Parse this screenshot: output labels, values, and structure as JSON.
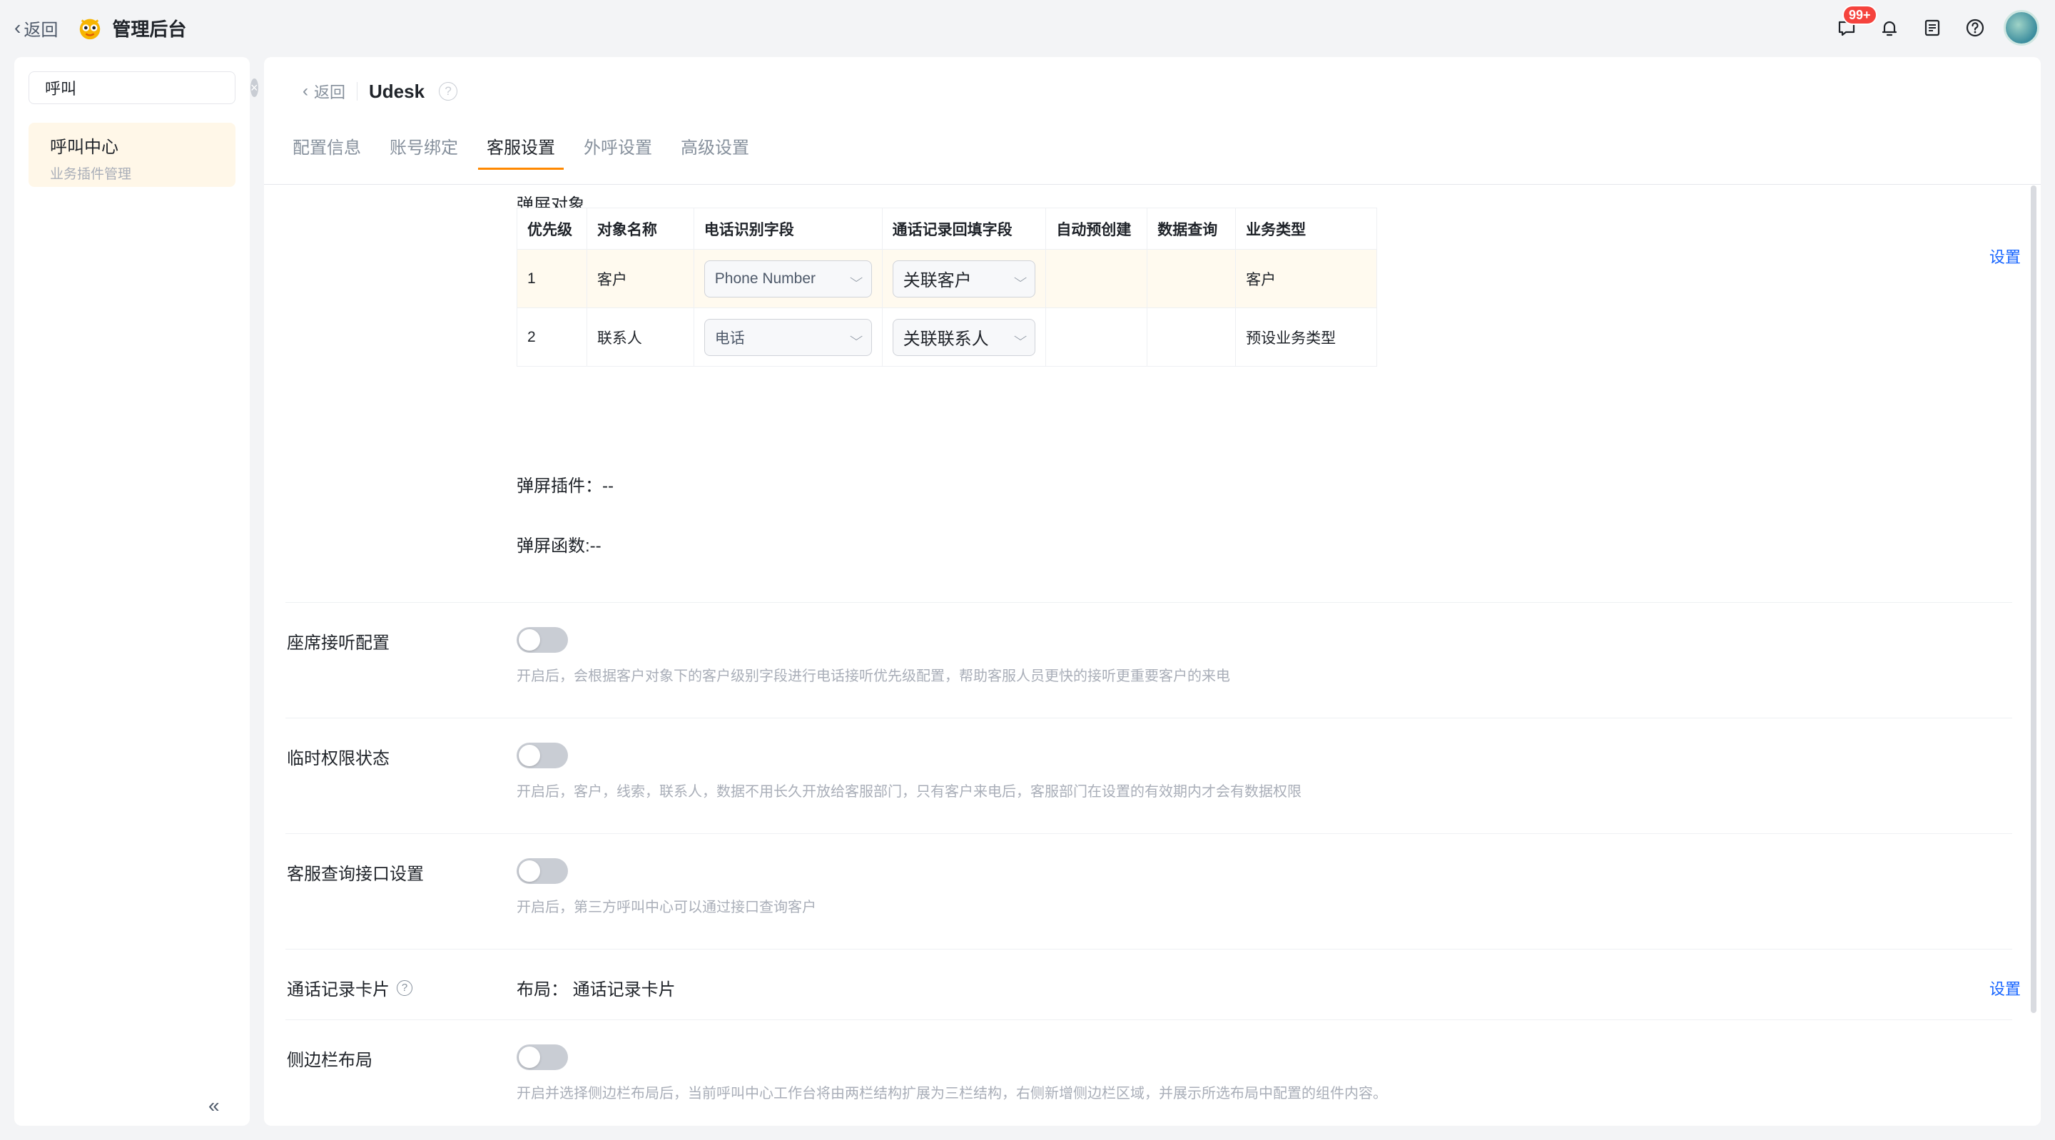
{
  "topbar": {
    "back_label": "返回",
    "title": "管理后台",
    "badge": "99+",
    "icons": [
      "message-icon",
      "bell-icon",
      "notes-icon",
      "help-icon"
    ]
  },
  "left": {
    "search_value": "呼叫",
    "nav_item": {
      "title": "呼叫中心",
      "subtitle": "业务插件管理"
    }
  },
  "main": {
    "back_label": "返回",
    "name": "Udesk",
    "help": "?",
    "tabs": [
      "配置信息",
      "账号绑定",
      "客服设置",
      "外呼设置",
      "高级设置"
    ],
    "active_tab": "客服设置",
    "popup": {
      "title": "弹屏对象",
      "set_link": "设置",
      "columns": [
        "优先级",
        "对象名称",
        "电话识别字段",
        "通话记录回填字段",
        "自动预创建",
        "数据查询",
        "业务类型"
      ],
      "rows": [
        {
          "priority": "1",
          "object": "客户",
          "phone_field": "Phone Number",
          "fill_field": "关联客户",
          "auto": "",
          "query": "",
          "biz": "客户"
        },
        {
          "priority": "2",
          "object": "联系人",
          "phone_field": "电话",
          "fill_field": "关联联系人",
          "auto": "",
          "query": "",
          "biz": "预设业务类型"
        }
      ],
      "plugin": "弹屏插件：--",
      "function": "弹屏函数:--"
    },
    "settings": [
      {
        "label": "座席接听配置",
        "desc": "开启后，会根据客户对象下的客户级别字段进行电话接听优先级配置，帮助客服人员更快的接听更重要客户的来电",
        "on": false
      },
      {
        "label": "临时权限状态",
        "desc": "开启后，客户，线索，联系人，数据不用长久开放给客服部门，只有客户来电后，客服部门在设置的有效期内才会有数据权限",
        "on": false
      },
      {
        "label": "客服查询接口设置",
        "desc": "开启后，第三方呼叫中心可以通过接口查询客户",
        "on": false
      }
    ],
    "call_card": {
      "label": "通话记录卡片",
      "layout": "布局：  通话记录卡片",
      "set_link": "设置"
    },
    "sidebar_layout": {
      "label": "侧边栏布局",
      "desc": "开启并选择侧边栏布局后，当前呼叫中心工作台将由两栏结构扩展为三栏结构，右侧新增侧边栏区域，并展示所选布局中配置的组件内容。",
      "on": false
    }
  },
  "colors": {
    "accent": "#ff8800",
    "link": "#1664ff",
    "badge": "#f5433d"
  }
}
